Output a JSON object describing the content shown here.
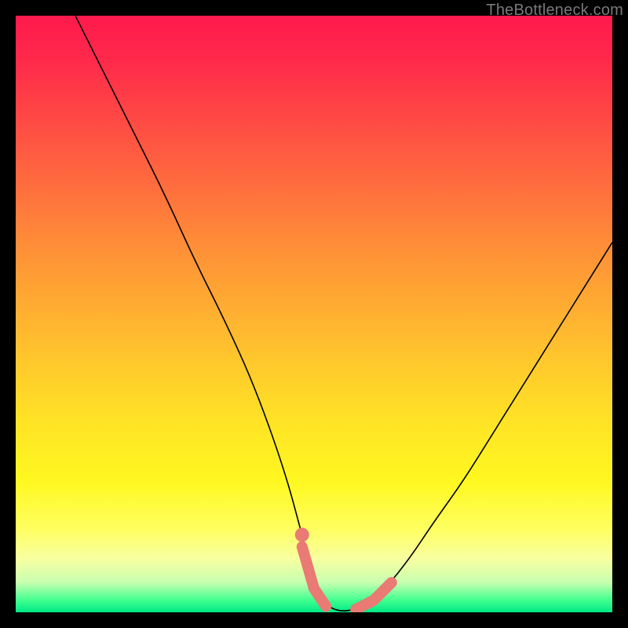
{
  "watermark": {
    "text": "TheBottleneck.com"
  },
  "colors": {
    "pink": "#e97a74",
    "black": "#000000"
  },
  "chart_data": {
    "type": "line",
    "title": "",
    "xlabel": "",
    "ylabel": "",
    "xlim": [
      0,
      100
    ],
    "ylim": [
      0,
      100
    ],
    "series": [
      {
        "name": "curve",
        "x": [
          10,
          15,
          20,
          25,
          30,
          35,
          40,
          45,
          48,
          50,
          52,
          55,
          58,
          62,
          66,
          70,
          75,
          80,
          85,
          90,
          95,
          100
        ],
        "values": [
          100,
          90,
          80,
          70,
          59,
          49,
          38,
          24,
          13,
          5,
          1,
          0,
          1,
          4,
          9,
          15,
          22,
          30,
          38,
          46,
          54,
          62
        ]
      }
    ],
    "highlight": {
      "left_point": {
        "x": 48,
        "y": 13
      },
      "left_segment": [
        {
          "x": 48,
          "y": 11
        },
        {
          "x": 50,
          "y": 4
        },
        {
          "x": 52,
          "y": 1
        }
      ],
      "right_segment": [
        {
          "x": 57,
          "y": 0.5
        },
        {
          "x": 60,
          "y": 2
        },
        {
          "x": 63,
          "y": 5
        }
      ]
    }
  }
}
